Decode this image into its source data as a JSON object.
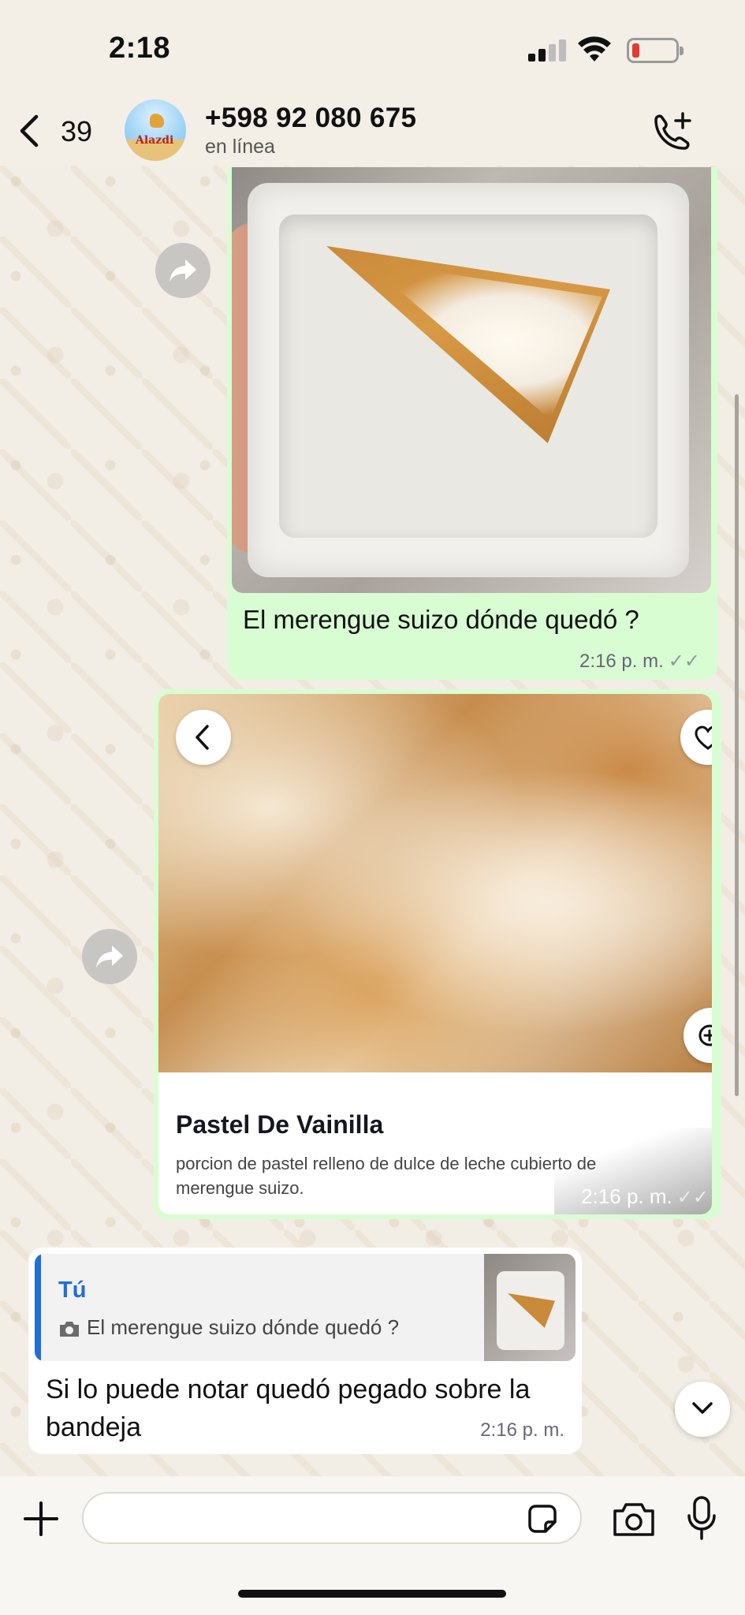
{
  "status_bar": {
    "time": "2:18"
  },
  "header": {
    "back_count": "39",
    "contact_name": "+598 92 080 675",
    "contact_status": "en línea",
    "avatar_text": "Alazdi"
  },
  "messages": [
    {
      "direction": "outgoing",
      "type": "photo",
      "caption": "El merengue suizo dónde quedó ?",
      "time": "2:16 p. m.",
      "status": "read"
    },
    {
      "direction": "outgoing",
      "type": "product_card",
      "title": "Pastel De Vainilla",
      "description": "porcion de pastel relleno de dulce de leche cubierto de merengue suizo.",
      "time": "2:16 p. m.",
      "status": "read"
    },
    {
      "direction": "incoming",
      "type": "reply",
      "quoted_author": "Tú",
      "quoted_text": "El merengue suizo dónde quedó ?",
      "text": "Si lo puede notar quedó pegado  sobre la bandeja",
      "time": "2:16 p. m."
    }
  ],
  "input": {
    "placeholder": "",
    "value": ""
  },
  "colors": {
    "outgoing_bubble": "#d9fdd3",
    "incoming_bubble": "#ffffff",
    "quote_accent": "#1e6fd9",
    "battery_low": "#e53935"
  },
  "icons": {
    "back": "chevron-left-icon",
    "call_add": "phone-plus-icon",
    "forward": "forward-arrow-icon",
    "plus": "plus-icon",
    "sticker": "sticker-icon",
    "camera": "camera-icon",
    "mic": "microphone-icon",
    "scroll_down": "chevron-down-icon"
  }
}
